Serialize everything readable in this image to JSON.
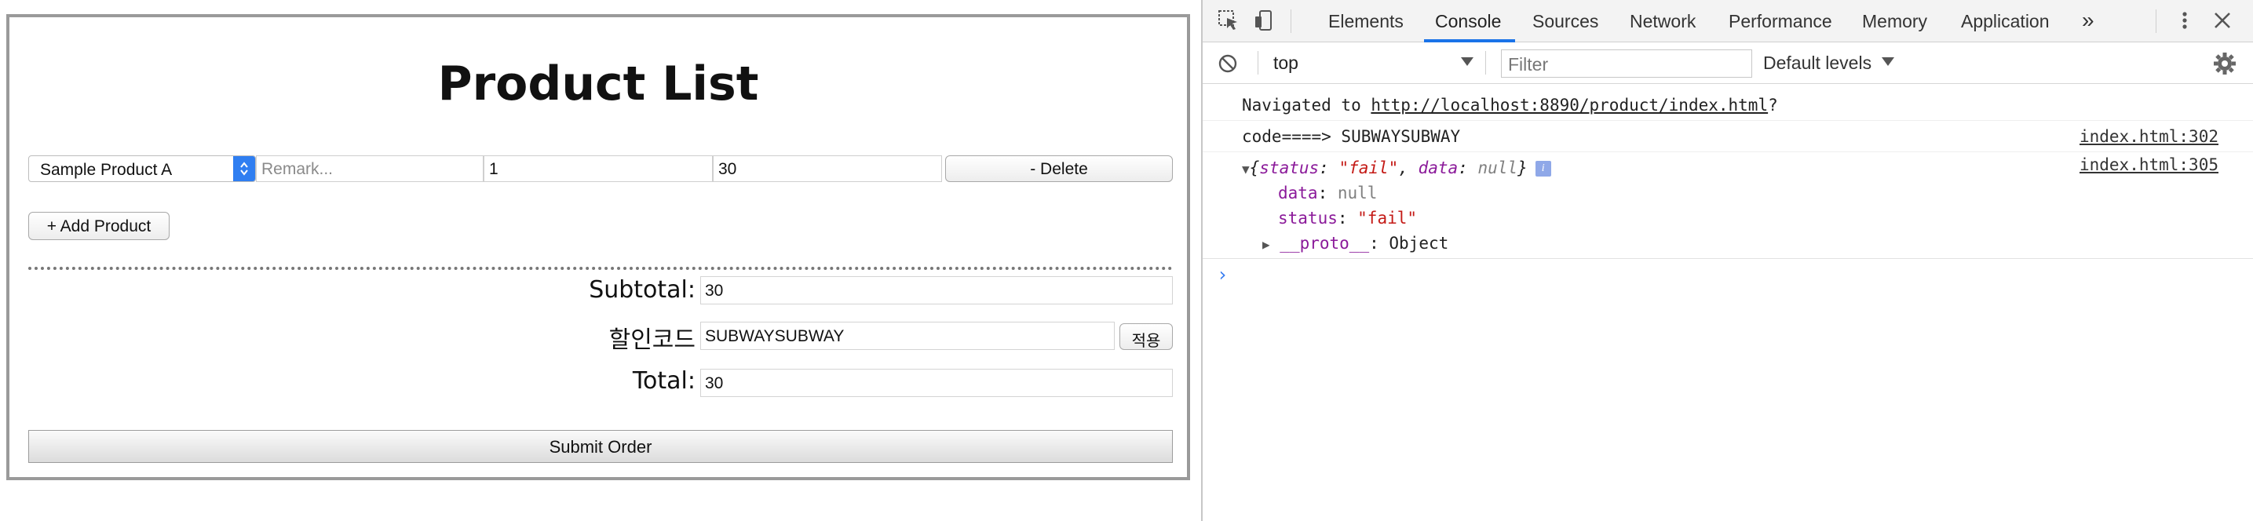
{
  "page": {
    "title": "Product List",
    "product_row": {
      "product_select": "Sample Product A",
      "remark_placeholder": "Remark...",
      "quantity": "1",
      "price": "30",
      "delete_label": "- Delete"
    },
    "add_product_label": "+ Add Product",
    "subtotal_label": "Subtotal:",
    "subtotal_value": "30",
    "discount_label": "할인코드",
    "discount_value": "SUBWAYSUBWAY",
    "apply_label": "적용",
    "total_label": "Total:",
    "total_value": "30",
    "submit_label": "Submit Order"
  },
  "devtools": {
    "tabs": [
      "Elements",
      "Console",
      "Sources",
      "Network",
      "Performance",
      "Memory",
      "Application"
    ],
    "active_tab": "Console",
    "more_tabs": "»",
    "context": "top",
    "filter_placeholder": "Filter",
    "levels": "Default levels",
    "console": {
      "nav_prefix": "Navigated to ",
      "nav_url": "http://localhost:8890/product/index.html",
      "nav_suffix": "?",
      "log1_text": "code====> SUBWAYSUBWAY",
      "log1_src": "index.html:302",
      "log2_src": "index.html:305",
      "obj_open": "{",
      "obj_status_key": "status",
      "obj_status_val": "\"fail\"",
      "obj_data_key": "data",
      "obj_data_val": "null",
      "obj_close": "}",
      "prop_data_key": "data",
      "prop_data_val": "null",
      "prop_status_key": "status",
      "prop_status_val": "\"fail\"",
      "proto_key": "__proto__",
      "proto_val": "Object",
      "prompt": "›"
    }
  }
}
